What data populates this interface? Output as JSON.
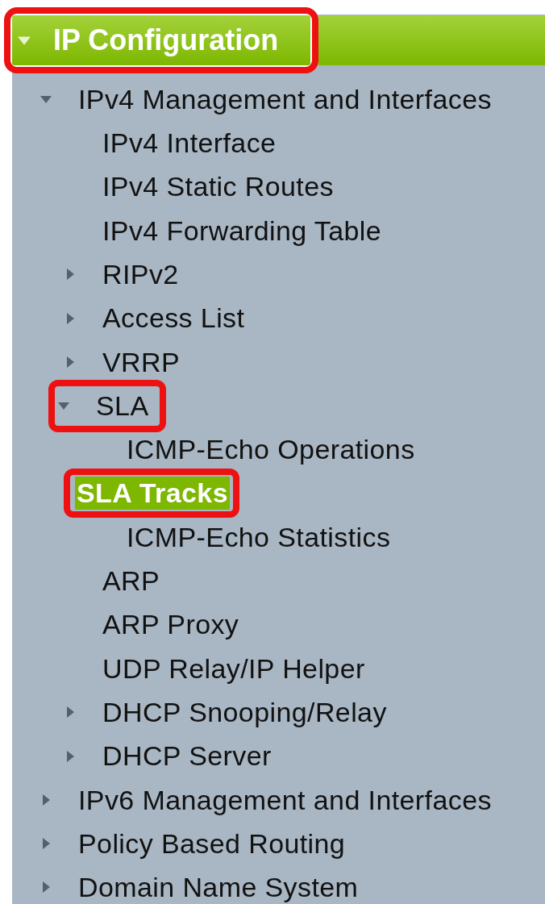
{
  "menu": {
    "title": "IP Configuration",
    "expanded": true,
    "highlighted": true,
    "items": [
      {
        "label": "IPv4 Management and Interfaces",
        "expanded": true,
        "selected": false,
        "highlighted": false,
        "children": [
          {
            "label": "IPv4 Interface",
            "selected": false,
            "highlighted": false
          },
          {
            "label": "IPv4 Static Routes",
            "selected": false,
            "highlighted": false
          },
          {
            "label": "IPv4 Forwarding Table",
            "selected": false,
            "highlighted": false
          },
          {
            "label": "RIPv2",
            "expanded": false,
            "selected": false,
            "highlighted": false
          },
          {
            "label": "Access List",
            "expanded": false,
            "selected": false,
            "highlighted": false
          },
          {
            "label": "VRRP",
            "expanded": false,
            "selected": false,
            "highlighted": false
          },
          {
            "label": "SLA",
            "expanded": true,
            "selected": false,
            "highlighted": true,
            "children": [
              {
                "label": "ICMP-Echo Operations",
                "selected": false,
                "highlighted": false
              },
              {
                "label": "SLA Tracks",
                "selected": true,
                "highlighted": true
              },
              {
                "label": "ICMP-Echo Statistics",
                "selected": false,
                "highlighted": false
              }
            ]
          },
          {
            "label": "ARP",
            "selected": false,
            "highlighted": false
          },
          {
            "label": "ARP Proxy",
            "selected": false,
            "highlighted": false
          },
          {
            "label": "UDP Relay/IP Helper",
            "selected": false,
            "highlighted": false
          },
          {
            "label": "DHCP Snooping/Relay",
            "expanded": false,
            "selected": false,
            "highlighted": false
          },
          {
            "label": "DHCP Server",
            "expanded": false,
            "selected": false,
            "highlighted": false
          }
        ]
      },
      {
        "label": "IPv6 Management and Interfaces",
        "expanded": false,
        "selected": false,
        "highlighted": false
      },
      {
        "label": "Policy Based Routing",
        "expanded": false,
        "selected": false,
        "highlighted": false
      },
      {
        "label": "Domain Name System",
        "expanded": false,
        "selected": false,
        "highlighted": false
      }
    ]
  }
}
